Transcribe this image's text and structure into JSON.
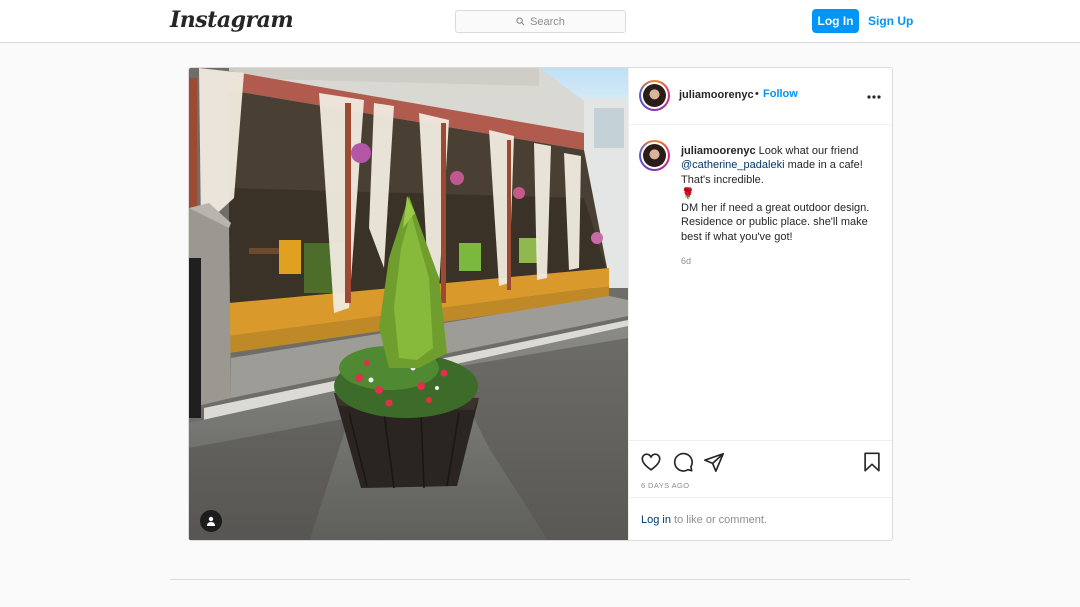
{
  "nav": {
    "logo": "Instagram",
    "search_placeholder": "Search",
    "login_label": "Log In",
    "signup_label": "Sign Up"
  },
  "post": {
    "username": "juliamoorenyc",
    "dot": "•",
    "follow_label": "Follow",
    "more_icon": "more-horizontal-icon",
    "caption": {
      "username": "juliamoorenyc",
      "text1": "Look what our friend",
      "mention": "@catherine_padaleki",
      "text2": "made in a cafe! That's incredible.",
      "emoji": "🌹",
      "text3": "DM her if need a great outdoor design. Residence or public place. she'll make best if what you've got!"
    },
    "caption_age": "6d",
    "timestamp": "6 DAYS AGO",
    "comment_login": "Log in",
    "comment_rest": "to like or comment.",
    "icons": [
      "heart-icon",
      "comment-icon",
      "share-icon",
      "bookmark-icon",
      "tagged-user-icon"
    ]
  },
  "colors": {
    "accent": "#0095f6",
    "link_dark": "#00376b",
    "muted": "#8e8e8e",
    "border": "#dbdbdb",
    "background": "#fafafa"
  }
}
